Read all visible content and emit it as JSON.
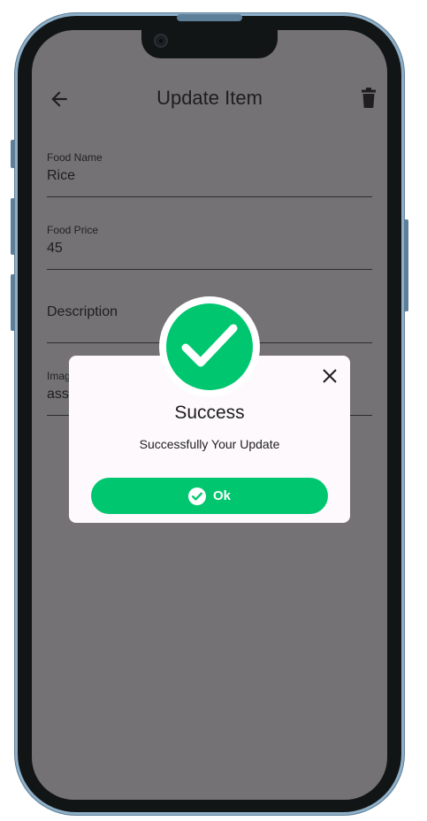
{
  "appbar": {
    "title": "Update Item",
    "back_icon": "arrow-left-icon",
    "delete_icon": "trash-icon"
  },
  "form": {
    "food_name": {
      "label": "Food Name",
      "value": "Rice"
    },
    "food_price": {
      "label": "Food Price",
      "value": "45"
    },
    "description": {
      "placeholder": "Description"
    },
    "image": {
      "label": "Imag",
      "value": "ass"
    }
  },
  "dialog": {
    "title": "Success",
    "message": "Successfully Your Update",
    "ok_label": "Ok",
    "close_icon": "close-icon",
    "badge_icon": "check-icon"
  },
  "colors": {
    "accent_green": "#00c76f",
    "overlay": "#757275",
    "dialog_bg": "#fdf9fd",
    "phone_frame": "#8fb0c8"
  }
}
